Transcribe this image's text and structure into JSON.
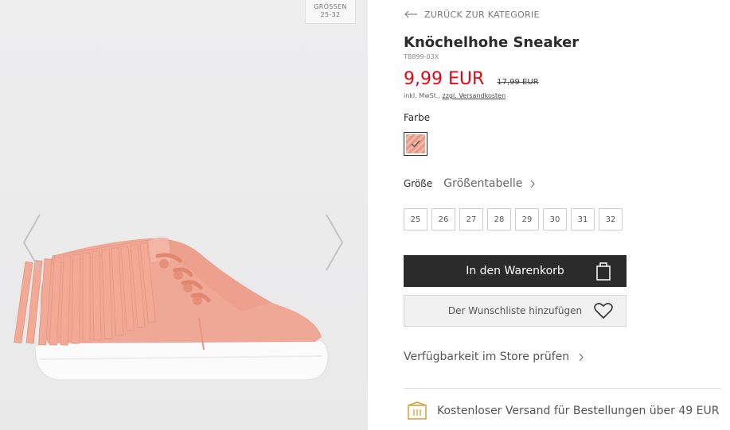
{
  "gallery": {
    "size_badge_line1": "GRÖSSEN",
    "size_badge_line2": "25-32"
  },
  "product": {
    "back_link": "ZURÜCK ZUR KATEGORIE",
    "title": "Knöchelhohe Sneaker",
    "sku": "TB899-03X",
    "price": "9,99 EUR",
    "old_price": "17,99 EUR",
    "tax_note": "inkl. MwSt.,",
    "shipping_costs_link": "zzgl. Versandkosten",
    "color_label": "Farbe",
    "size_label": "Größe",
    "size_table_link": "Größentabelle",
    "sizes": [
      "25",
      "26",
      "27",
      "28",
      "29",
      "30",
      "31",
      "32"
    ],
    "add_to_cart": "In den Warenkorb",
    "add_to_wishlist": "Der Wunschliste hinzufügen",
    "store_availability": "Verfügbarkeit im Store prüfen",
    "free_shipping": "Kostenloser Versand für Bestellungen über 49 EUR"
  },
  "colors": {
    "price_red": "#e30613",
    "button_dark": "#2b2b2b",
    "shoe_pink": "#f0a896",
    "accent_gold": "#d9a441"
  }
}
